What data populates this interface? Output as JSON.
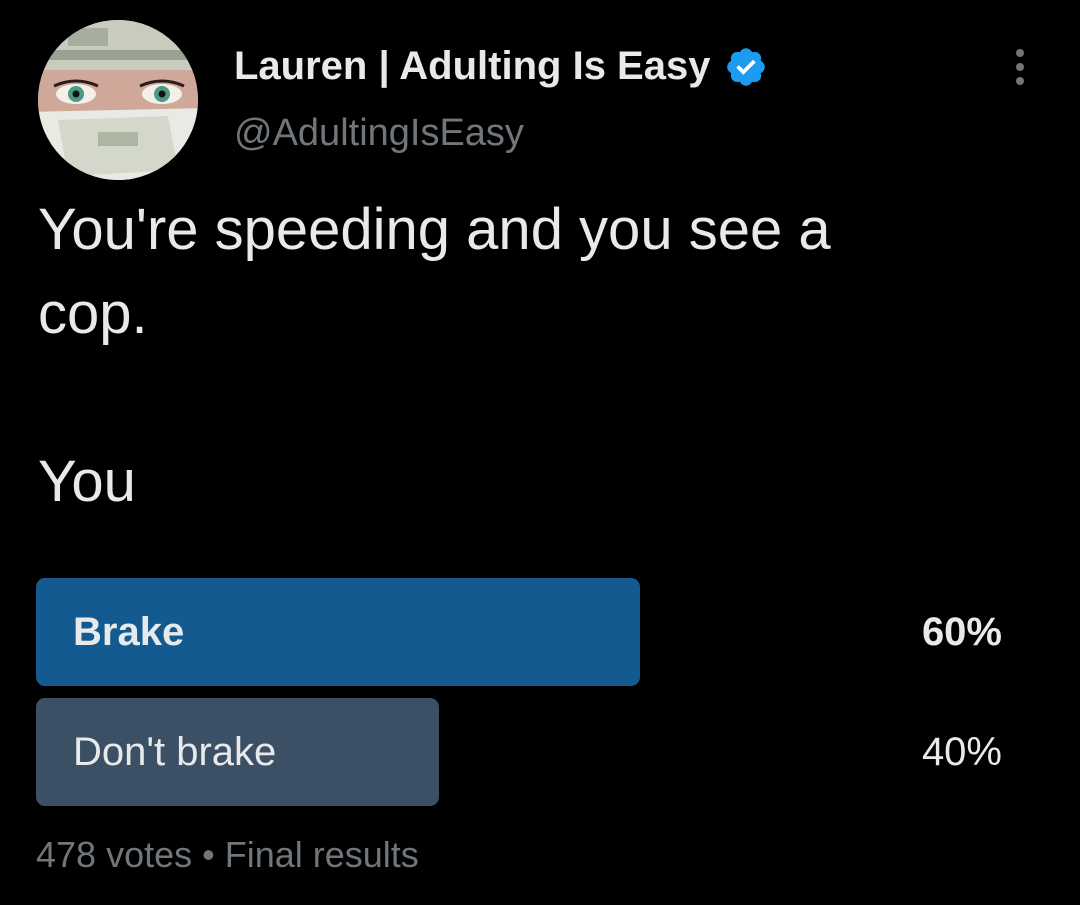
{
  "author": {
    "display_name": "Lauren | Adulting Is Easy",
    "handle": "@AdultingIsEasy",
    "verified": true,
    "avatar_icon": "profile-photo-eyes-money"
  },
  "tweet": {
    "text": "You're speeding and you see a\ncop.\n\nYou"
  },
  "poll": {
    "options": [
      {
        "label": "Brake",
        "percent_text": "60%",
        "percent": 60,
        "winner": true,
        "bar_color": "#125a8f"
      },
      {
        "label": "Don't brake",
        "percent_text": "40%",
        "percent": 40,
        "winner": false,
        "bar_color": "#3b5064"
      }
    ],
    "votes": "478 votes",
    "separator": "•",
    "status": "Final results"
  },
  "colors": {
    "background": "#000000",
    "text_primary": "#e7e9ea",
    "text_secondary": "#71767b",
    "verified_blue": "#1d9bf0"
  }
}
